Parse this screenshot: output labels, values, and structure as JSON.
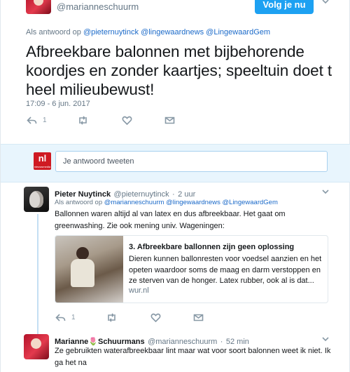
{
  "tweet": {
    "handle": "@marianneschuurm",
    "follow_label": "Volg je nu",
    "reply_prefix": "Als antwoord op",
    "reply_to": [
      "@pieternuytinck",
      "@lingewaardnews",
      "@LingewaardGem"
    ],
    "text": "Afbreekbare balonnen met bijbehorende koordjes en zonder kaartjes; speeltuin doet t heel milieubewust!",
    "timestamp": "17:09 - 6 jun. 2017",
    "reply_count": "1",
    "retweet_count": "",
    "like_count": ""
  },
  "reply_box": {
    "logo_text": "nl",
    "logo_subtext": "nieuwsmedia",
    "placeholder": "Je antwoord tweeten"
  },
  "replies": [
    {
      "name": "Pieter Nuytinck",
      "handle": "@pieternuytinck",
      "time": "2 uur",
      "reply_prefix": "Als antwoord op",
      "reply_to": [
        "@marianneschuurm",
        "@lingewaardnews",
        "@LingewaardGem"
      ],
      "text": "Ballonnen waren altijd al van latex en dus afbreekbaar. Het gaat om greenwashing. Zie ook mening univ. Wageningen:",
      "card": {
        "title": "3. Afbreekbare ballonnen zijn geen oplossing",
        "description": "Dieren kunnen ballonresten voor voedsel aanzien en het opeten waardoor soms de maag en darm verstoppen en ze sterven van de honger. Latex rubber, ook al is dat...",
        "domain": "wur.nl"
      },
      "reply_count": "1"
    },
    {
      "name": "Marianne",
      "name_emoji": "🌷",
      "name_rest": "Schuurmans",
      "handle": "@marianneschuurm",
      "time": "52 min",
      "text": "Ze gebruikten waterafbreekbaar lint maar wat voor soort balonnen weet ik niet. Ik ga het na"
    }
  ],
  "icons": {
    "reply": "reply-icon",
    "retweet": "retweet-icon",
    "like": "heart-icon",
    "dm": "envelope-icon",
    "more": "chevron-down-icon"
  },
  "colors": {
    "accent": "#1da1f2",
    "link": "#1b6ac9",
    "muted": "#657786",
    "reply_band": "#e8f5fd",
    "brand_red": "#cf1a22"
  }
}
